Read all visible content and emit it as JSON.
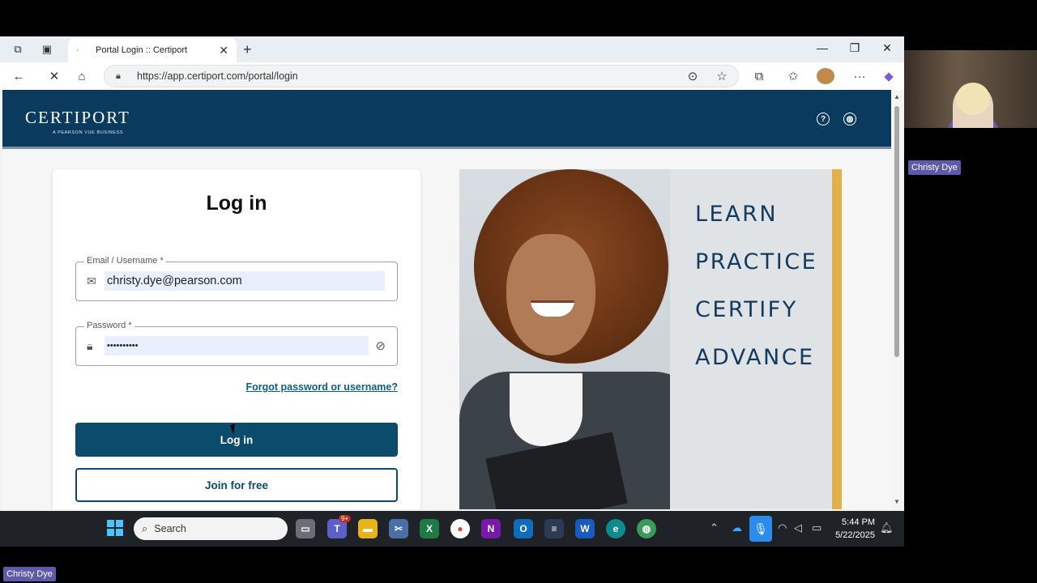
{
  "browser": {
    "tab_title": "Portal Login :: Certiport",
    "tab_favicon": "·",
    "url": "https://app.certiport.com/portal/login"
  },
  "site": {
    "logo_text": "CERTIPORT",
    "logo_tagline": "A PEARSON VUE BUSINESS",
    "help_icon_glyph": "?",
    "brand_color": "#0b3a5f"
  },
  "login": {
    "heading": "Log in",
    "email_label": "Email / Username  *",
    "email_value": "christy.dye@pearson.com",
    "password_label": "Password *",
    "password_value": "••••••••••",
    "forgot_link": "Forgot password or username?",
    "login_button": "Log in",
    "join_button": "Join for free"
  },
  "hero": {
    "words": [
      "LEARN",
      "PRACTICE",
      "CERTIFY",
      "ADVANCE"
    ],
    "accent_color": "#e2b14a"
  },
  "taskbar": {
    "search_placeholder": "Search",
    "teams_badge": "9+",
    "time": "5:44 PM",
    "date": "5/22/2025"
  },
  "meeting": {
    "participant_name": "Christy Dye",
    "self_name": "Christy Dye"
  }
}
